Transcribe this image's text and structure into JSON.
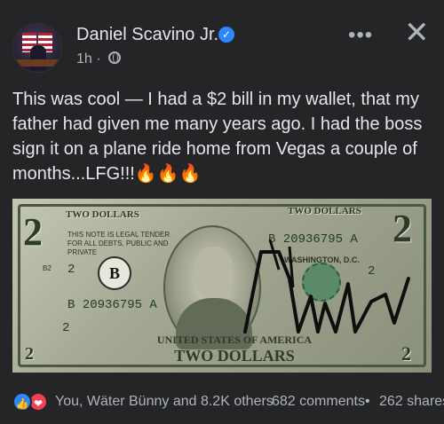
{
  "post": {
    "author": "Daniel Scavino Jr.",
    "time": "1h",
    "separator": "·",
    "more_label": "•••",
    "close_label": "✕",
    "verified_label": "✓",
    "text_lines": [
      "This was cool — I had a $2 bill in my wallet, that my",
      "father had given me many years ago. I had the boss",
      "sign it on a plane ride home from Vegas a couple of",
      "months...LFG!!!"
    ],
    "emoji": "🔥🔥🔥"
  },
  "photo": {
    "corner_number": "2",
    "top_left_label": "TWO DOLLARS",
    "top_right_label": "TWO DOLLARS",
    "legal_tender": "THIS NOTE IS LEGAL TENDER FOR ALL DEBTS, PUBLIC AND PRIVATE",
    "serial_top": "B 20936795 A",
    "serial_left": "B 20936795 A",
    "federal_letter": "B",
    "side_num_left": "2",
    "side_num_right": "2",
    "location": "WASHINGTON, D.C.",
    "united_states": "UNITED STATES OF AMERICA",
    "denomination": "TWO DOLLARS",
    "plate": "B2"
  },
  "footer": {
    "like_icon": "👍",
    "love_icon": "❤",
    "reactions": "You, Wäter Bünny and 8.2K others",
    "comments": "682 comments",
    "dot": "•",
    "shares": "262 shares"
  },
  "colors": {
    "background": "#242526",
    "text": "#e4e6eb",
    "secondary": "#b0b3b8",
    "verified": "#2d88ff",
    "like": "#2d88ff",
    "love": "#f33e58"
  }
}
